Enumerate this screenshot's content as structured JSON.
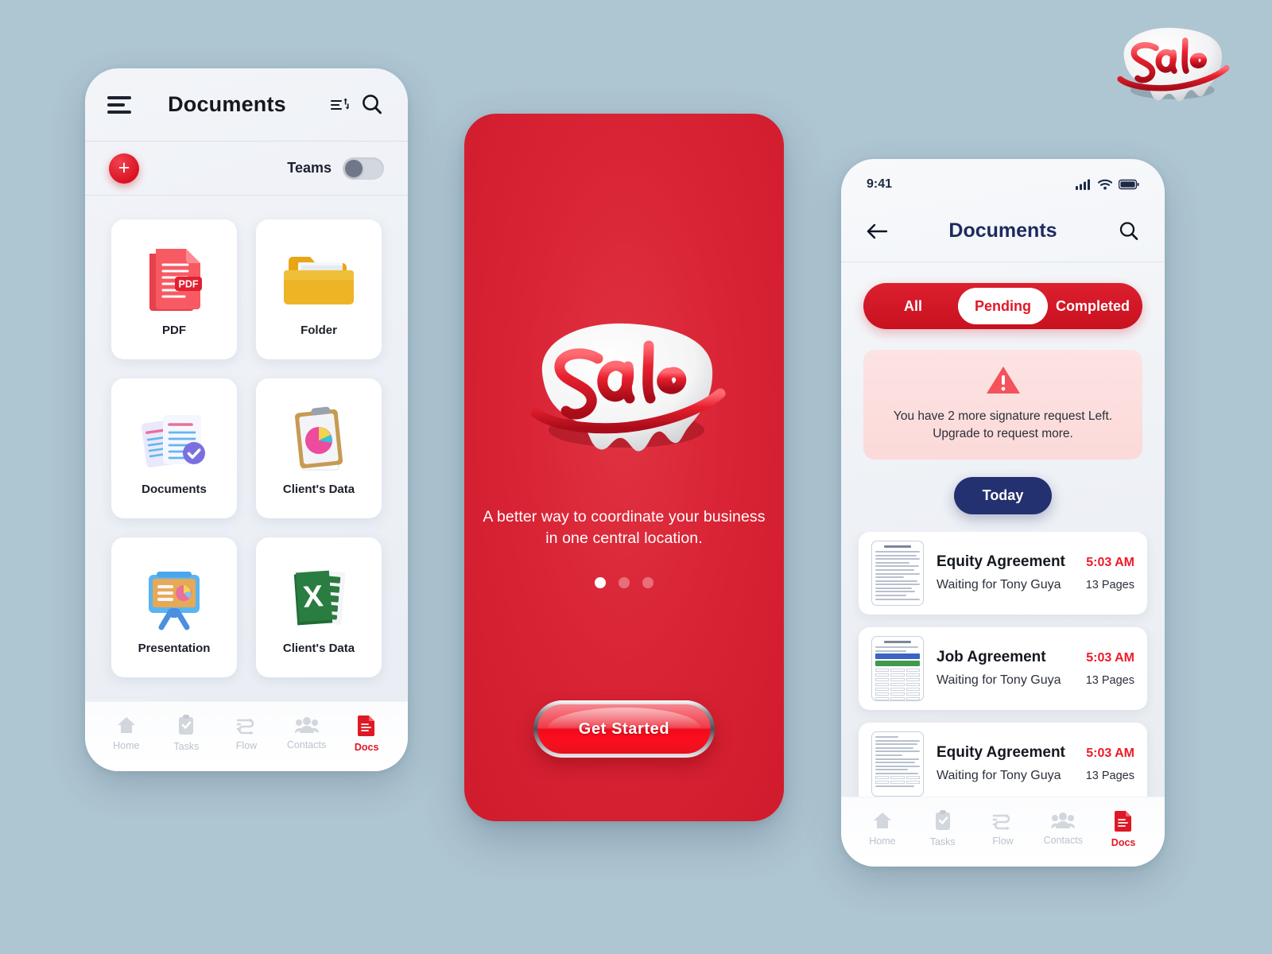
{
  "canvas": {
    "background_color": "#aec5d2"
  },
  "brand": {
    "logo_text": "Sale",
    "accent_red": "#e01826",
    "navy": "#233170"
  },
  "phone1": {
    "header": {
      "title": "Documents",
      "menu_icon": "hamburger-icon",
      "sort_icon": "sort-icon",
      "search_icon": "search-icon"
    },
    "subbar": {
      "add_label": "+",
      "teams_label": "Teams",
      "teams_toggle_state": "off"
    },
    "grid": [
      {
        "label": "PDF",
        "icon": "pdf-file-icon"
      },
      {
        "label": "Folder",
        "icon": "folder-icon"
      },
      {
        "label": "Documents",
        "icon": "documents-check-icon"
      },
      {
        "label": "Client's Data",
        "icon": "clipboard-chart-icon"
      },
      {
        "label": "Presentation",
        "icon": "presentation-board-icon"
      },
      {
        "label": "Client's Data",
        "icon": "excel-file-icon"
      }
    ],
    "nav": [
      {
        "label": "Home",
        "icon": "home-icon",
        "active": false
      },
      {
        "label": "Tasks",
        "icon": "clipboard-check-icon",
        "active": false
      },
      {
        "label": "Flow",
        "icon": "flow-icon",
        "active": false
      },
      {
        "label": "Contacts",
        "icon": "contacts-icon",
        "active": false
      },
      {
        "label": "Docs",
        "icon": "docs-icon",
        "active": true
      }
    ]
  },
  "phone2": {
    "logo_text": "Sale",
    "tagline_line1": "A better way to coordinate your business",
    "tagline_line2": "in one central location.",
    "dots": [
      {
        "active": true
      },
      {
        "active": false
      },
      {
        "active": false
      }
    ],
    "cta_label": "Get Started"
  },
  "phone3": {
    "status": {
      "time": "9:41",
      "signal_icon": "cellular-signal-icon",
      "wifi_icon": "wifi-icon",
      "battery_icon": "battery-icon"
    },
    "header": {
      "back_icon": "back-arrow-icon",
      "title": "Documents",
      "search_icon": "search-icon"
    },
    "segments": [
      {
        "label": "All",
        "active": false
      },
      {
        "label": "Pending",
        "active": true
      },
      {
        "label": "Completed",
        "active": false
      }
    ],
    "alert": {
      "icon": "warning-triangle-icon",
      "line1": "You have 2 more signature request Left.",
      "line2": "Upgrade to request more."
    },
    "today_label": "Today",
    "documents": [
      {
        "title": "Equity Agreement",
        "time": "5:03 AM",
        "subtitle": "Waiting for Tony Guya",
        "pages": "13 Pages",
        "thumb": "text-document"
      },
      {
        "title": "Job Agreement",
        "time": "5:03 AM",
        "subtitle": "Waiting for Tony Guya",
        "pages": "13 Pages",
        "thumb": "table-document"
      },
      {
        "title": "Equity Agreement",
        "time": "5:03 AM",
        "subtitle": "Waiting for Tony Guya",
        "pages": "13 Pages",
        "thumb": "text-document"
      }
    ],
    "nav": [
      {
        "label": "Home",
        "icon": "home-icon",
        "active": false
      },
      {
        "label": "Tasks",
        "icon": "clipboard-check-icon",
        "active": false
      },
      {
        "label": "Flow",
        "icon": "flow-icon",
        "active": false
      },
      {
        "label": "Contacts",
        "icon": "contacts-icon",
        "active": false
      },
      {
        "label": "Docs",
        "icon": "docs-icon",
        "active": true
      }
    ]
  }
}
